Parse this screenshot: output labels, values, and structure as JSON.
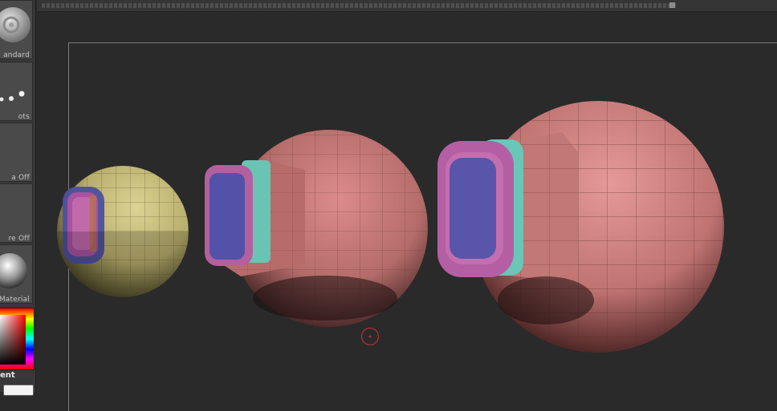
{
  "left_shelf": {
    "slots": [
      {
        "label": "Standard",
        "shown": "andard"
      },
      {
        "label": "Dots",
        "shown": "ots"
      },
      {
        "label": "Alpha Off",
        "shown": "a Off"
      },
      {
        "label": "Texture Off",
        "shown": "re Off"
      },
      {
        "label": "Material",
        "shown": "Material"
      }
    ],
    "gradient_label": "ent"
  },
  "colors": {
    "background": "#2a2a2a",
    "shelf": "#383838",
    "sphere_small": "#c9c080",
    "sphere_pink": "#c97a78",
    "polygroup_blue": "#5553a8",
    "polygroup_magenta": "#b05aa8",
    "polygroup_teal": "#5fc0b0",
    "cursor": "#b03030"
  },
  "viewport": {
    "objects": [
      {
        "name": "small-yellow-sphere",
        "icon": "sphere-mesh"
      },
      {
        "name": "medium-pink-sphere",
        "icon": "sphere-mesh"
      },
      {
        "name": "large-pink-sphere",
        "icon": "sphere-mesh"
      }
    ],
    "cursor_icon": "brush-cursor-circle"
  }
}
